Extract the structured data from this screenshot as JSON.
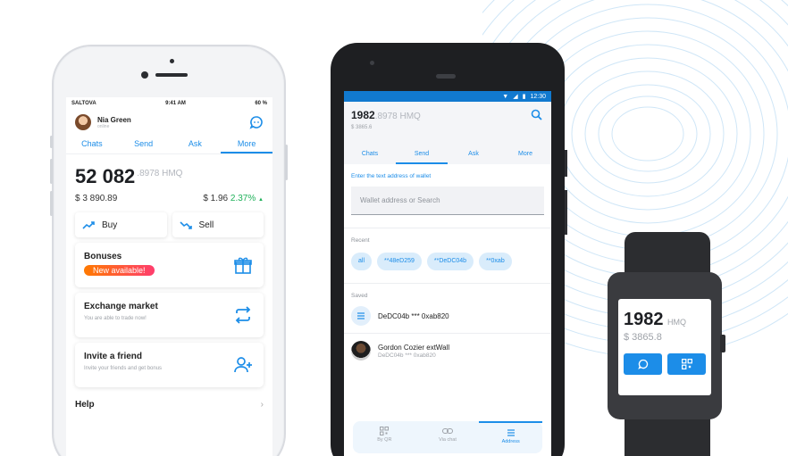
{
  "iphone": {
    "status": {
      "carrier": "SALTOVA",
      "time": "9:41 AM",
      "battery": "60 %"
    },
    "user": {
      "name": "Nia Green",
      "status": "online"
    },
    "tabs": [
      "Chats",
      "Send",
      "Ask",
      "More"
    ],
    "active_tab": 3,
    "balance": {
      "int": "52 082",
      "dec": ".8978 HMQ"
    },
    "usd": "$ 3 890.89",
    "change_value": "$ 1.96",
    "change_pct": "2.37%",
    "change_icon": "up-triangle",
    "buy_label": "Buy",
    "sell_label": "Sell",
    "cards": [
      {
        "title": "Bonuses",
        "badge": "New available!",
        "icon": "gift-icon"
      },
      {
        "title": "Exchange market",
        "subtitle": "You are able to trade now!",
        "icon": "exchange-icon"
      },
      {
        "title": "Invite a friend",
        "subtitle": "Invite your friends and get bonus",
        "icon": "add-user-icon"
      }
    ],
    "help_label": "Help",
    "accent": "#1c8de8"
  },
  "android": {
    "status": {
      "time": "12:30"
    },
    "balance": {
      "int": "1982",
      "dec": ".8978 HMQ"
    },
    "usd": "$ 3865.6",
    "tabs": [
      "Chats",
      "Send",
      "Ask",
      "More"
    ],
    "active_tab": 1,
    "form_label": "Enter the text address of wallet",
    "input_placeholder": "Wallet address or Search",
    "recent_label": "Recent",
    "recent_chips": [
      "all",
      "**48eD259",
      "**DeDC04b",
      "**0xab"
    ],
    "saved_label": "Saved",
    "saved": [
      {
        "title": "DeDC04b *** 0xab820",
        "icon": "list-icon"
      },
      {
        "title": "Gordon Cozier extWall",
        "subtitle": "DeDC04b *** 0xab820",
        "icon": "photo"
      }
    ],
    "bottom_nav": [
      "By QR",
      "Via chat",
      "Address"
    ],
    "bottom_active": 2
  },
  "watch": {
    "balance": "1982",
    "currency": "HMQ",
    "usd": "$ 3865.8",
    "buttons": [
      "chat-icon",
      "qr-icon"
    ]
  }
}
